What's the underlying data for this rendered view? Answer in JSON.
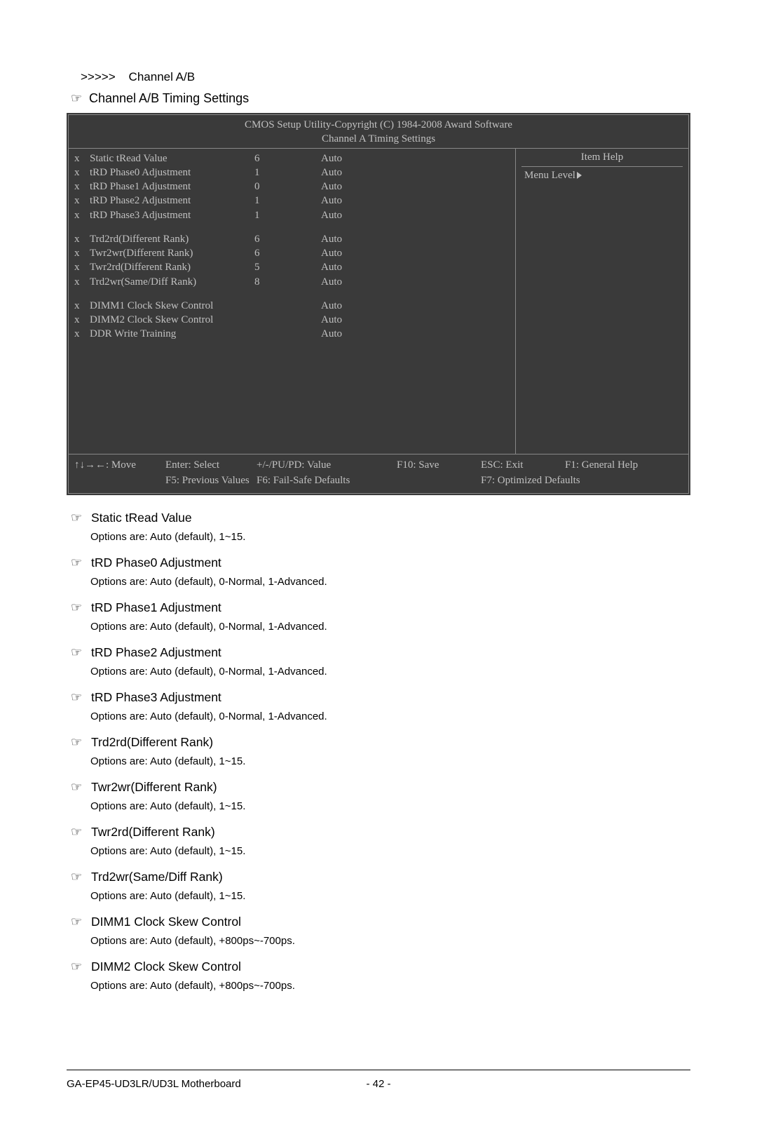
{
  "breadcrumb_prefix": ">>>>>",
  "breadcrumb": "Channel A/B",
  "section_title": "Channel A/B Timing Settings",
  "bios": {
    "header1": "CMOS Setup Utility-Copyright (C) 1984-2008 Award Software",
    "header2": "Channel A Timing Settings",
    "right_head": "Item Help",
    "menu_level": "Menu Level",
    "rows1": [
      {
        "mark": "x",
        "label": "Static tRead Value",
        "v1": "6",
        "v2": "Auto"
      },
      {
        "mark": "x",
        "label": "tRD Phase0 Adjustment",
        "v1": "1",
        "v2": "Auto"
      },
      {
        "mark": "x",
        "label": "tRD Phase1 Adjustment",
        "v1": "0",
        "v2": "Auto"
      },
      {
        "mark": "x",
        "label": "tRD Phase2 Adjustment",
        "v1": "1",
        "v2": "Auto"
      },
      {
        "mark": "x",
        "label": "tRD Phase3 Adjustment",
        "v1": "1",
        "v2": "Auto"
      }
    ],
    "rows2": [
      {
        "mark": "x",
        "label": "Trd2rd(Different Rank)",
        "v1": "6",
        "v2": "Auto"
      },
      {
        "mark": "x",
        "label": "Twr2wr(Different Rank)",
        "v1": "6",
        "v2": "Auto"
      },
      {
        "mark": "x",
        "label": "Twr2rd(Different Rank)",
        "v1": "5",
        "v2": "Auto"
      },
      {
        "mark": "x",
        "label": "Trd2wr(Same/Diff Rank)",
        "v1": "8",
        "v2": "Auto"
      }
    ],
    "rows3": [
      {
        "mark": "x",
        "label": "DIMM1 Clock Skew Control",
        "v1": "",
        "v2": "Auto"
      },
      {
        "mark": "x",
        "label": "DIMM2 Clock Skew Control",
        "v1": "",
        "v2": "Auto"
      },
      {
        "mark": "x",
        "label": "DDR Write Training",
        "v1": "",
        "v2": "Auto"
      }
    ],
    "footer": {
      "r1": [
        "↑↓→←: Move",
        "Enter: Select",
        "+/-/PU/PD: Value",
        "F10: Save",
        "ESC: Exit",
        "F1: General Help"
      ],
      "r2": [
        "",
        "F5: Previous Values",
        "F6: Fail-Safe Defaults",
        "",
        "F7: Optimized Defaults",
        ""
      ]
    }
  },
  "options": [
    {
      "title": "Static tRead Value",
      "desc": "Options are: Auto (default), 1~15."
    },
    {
      "title": "tRD Phase0 Adjustment",
      "desc": "Options are: Auto (default), 0-Normal, 1-Advanced."
    },
    {
      "title": "tRD Phase1 Adjustment",
      "desc": "Options are: Auto (default), 0-Normal, 1-Advanced."
    },
    {
      "title": "tRD Phase2 Adjustment",
      "desc": "Options are: Auto (default), 0-Normal, 1-Advanced."
    },
    {
      "title": "tRD Phase3 Adjustment",
      "desc": "Options are: Auto (default), 0-Normal, 1-Advanced."
    },
    {
      "title": "Trd2rd(Different Rank)",
      "desc": "Options are: Auto (default), 1~15."
    },
    {
      "title": "Twr2wr(Different Rank)",
      "desc": "Options are: Auto (default), 1~15."
    },
    {
      "title": "Twr2rd(Different Rank)",
      "desc": "Options are: Auto (default), 1~15."
    },
    {
      "title": "Trd2wr(Same/Diff Rank)",
      "desc": "Options are: Auto (default), 1~15."
    },
    {
      "title": "DIMM1 Clock Skew Control",
      "desc": "Options are: Auto (default), +800ps~-700ps."
    },
    {
      "title": "DIMM2 Clock Skew Control",
      "desc": "Options are: Auto (default), +800ps~-700ps."
    }
  ],
  "footer_left": "GA-EP45-UD3LR/UD3L Motherboard",
  "footer_page": "- 42 -"
}
